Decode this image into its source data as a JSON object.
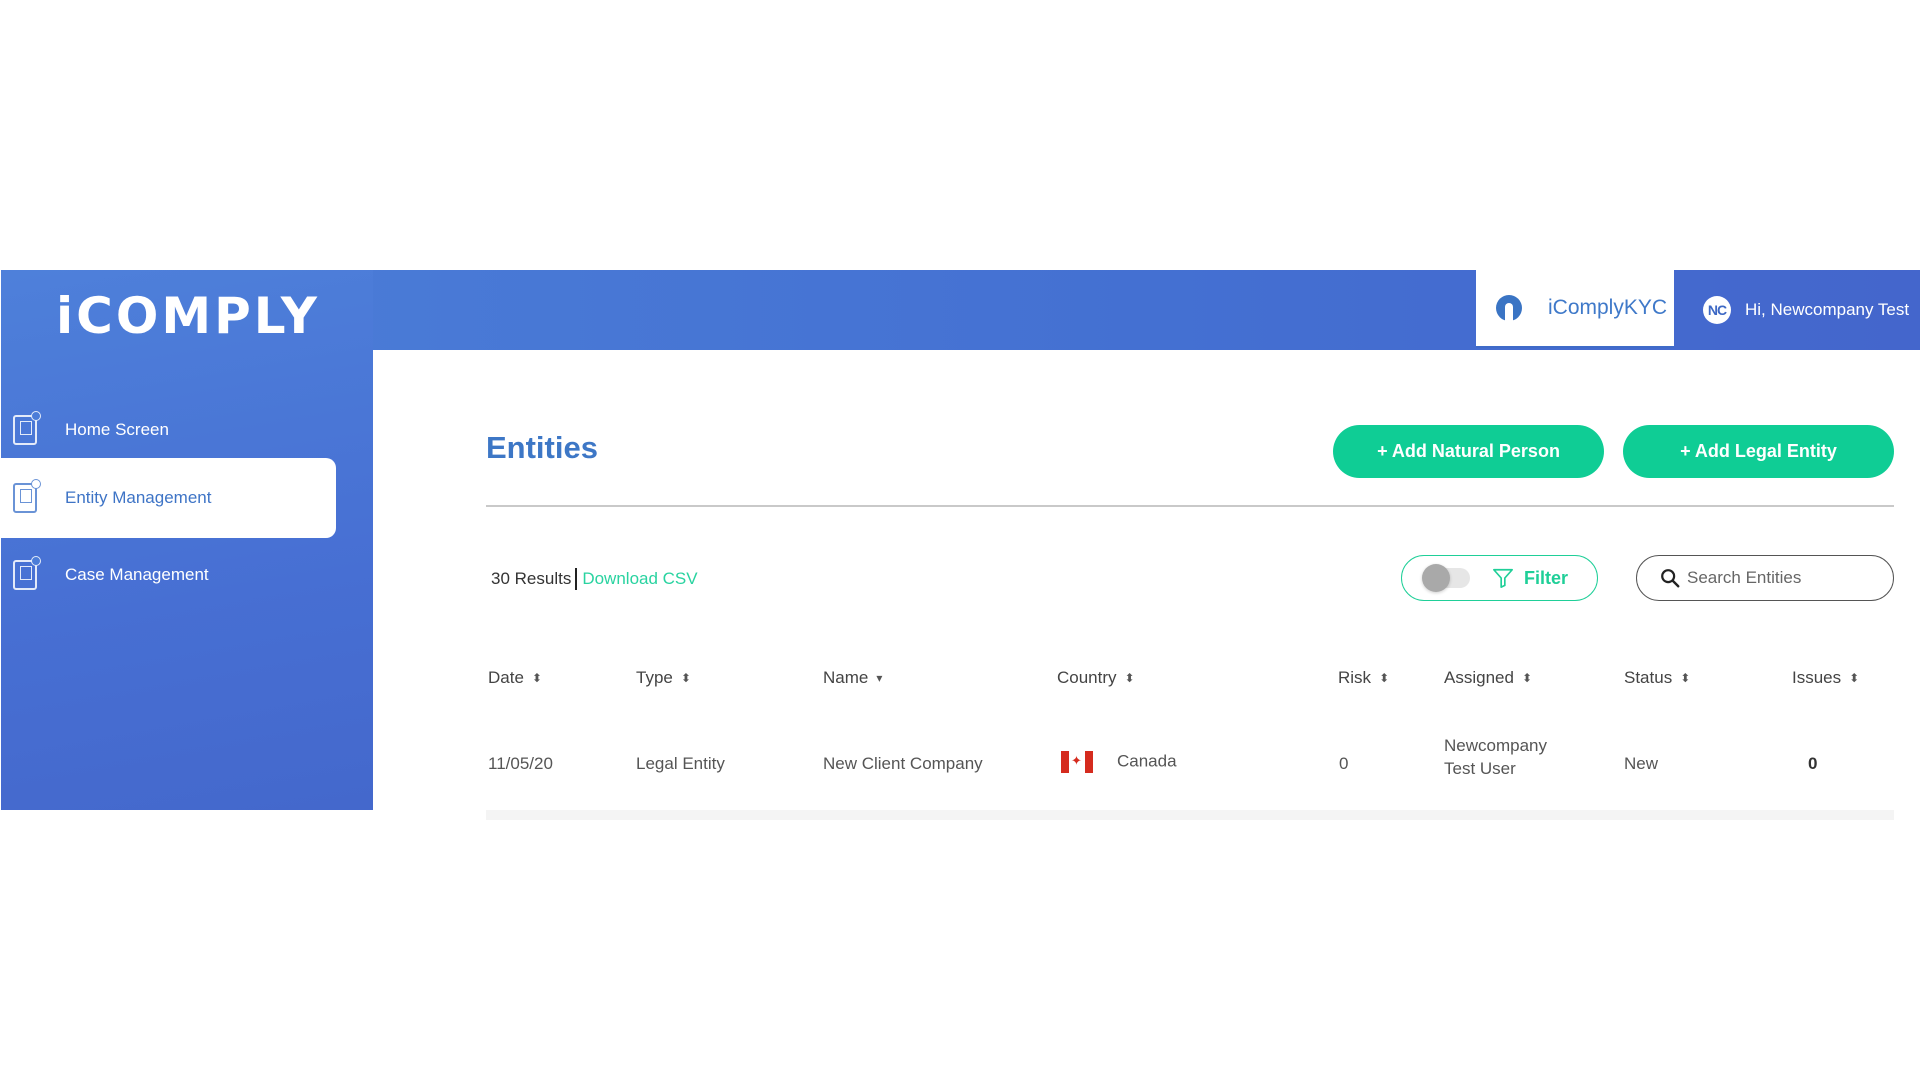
{
  "header": {
    "logo": "iCOMPLY",
    "app_tab_label": "iComplyKYC",
    "user_initials": "NC",
    "user_greeting": "Hi, Newcompany Test"
  },
  "sidebar": {
    "items": [
      {
        "label": "Home Screen",
        "icon": "mobile-id-icon",
        "active": false
      },
      {
        "label": "Entity Management",
        "icon": "mobile-id-icon",
        "active": true
      },
      {
        "label": "Case Management",
        "icon": "mobile-id-icon",
        "active": false
      }
    ]
  },
  "main": {
    "title": "Entities",
    "add_natural_person_label": "+ Add Natural Person",
    "add_legal_entity_label": "+ Add Legal Entity",
    "results_count": "30 Results",
    "download_csv_label": "Download CSV",
    "filter_label": "Filter",
    "filter_toggle_on": false,
    "search_placeholder": "Search Entities",
    "search_value": ""
  },
  "table": {
    "columns": [
      {
        "label": "Date",
        "sort": "both"
      },
      {
        "label": "Type",
        "sort": "both"
      },
      {
        "label": "Name",
        "sort": "desc"
      },
      {
        "label": "Country",
        "sort": "both"
      },
      {
        "label": "Risk",
        "sort": "both"
      },
      {
        "label": "Assigned",
        "sort": "both"
      },
      {
        "label": "Status",
        "sort": "both"
      },
      {
        "label": "Issues",
        "sort": "both"
      }
    ],
    "rows": [
      {
        "date": "11/05/20",
        "type": "Legal Entity",
        "name": "New Client Company",
        "country": "Canada",
        "country_flag": "canada-flag-icon",
        "risk": "0",
        "assigned": "Newcompany Test User",
        "status": "New",
        "issues": "0"
      }
    ]
  },
  "colors": {
    "brand_blue": "#4a78d6",
    "accent_green": "#0fcd95",
    "title_blue": "#3d77c6"
  }
}
